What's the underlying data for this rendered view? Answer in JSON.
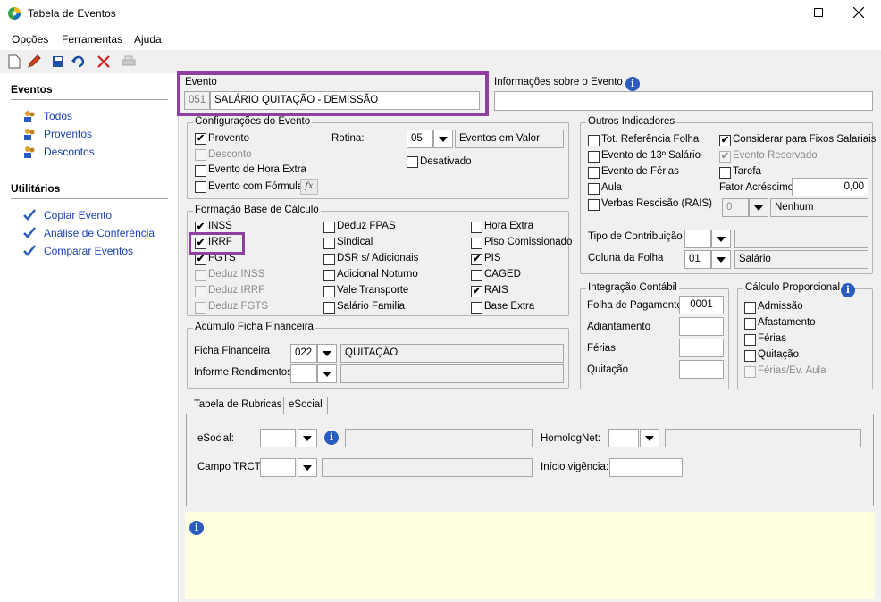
{
  "window": {
    "title": "Tabela de Eventos"
  },
  "menu": [
    "Opções",
    "Ferramentas",
    "Ajuda"
  ],
  "toolbar": [
    "new-doc-icon",
    "edit-icon",
    "save-icon",
    "undo-icon",
    "delete-icon",
    "print-icon"
  ],
  "sidebar": {
    "events_header": "Eventos",
    "events": [
      "Todos",
      "Proventos",
      "Descontos"
    ],
    "utils_header": "Utilitários",
    "utils": [
      "Copiar Evento",
      "Análise de Conferência",
      "Comparar Eventos"
    ]
  },
  "evento": {
    "legend": "Evento",
    "code": "051",
    "name": "SALÁRIO QUITAÇÃO - DEMISSÃO"
  },
  "info_evento": {
    "label": "Informações sobre o Evento",
    "value": ""
  },
  "config": {
    "legend": "Configurações do Evento",
    "provento": "Provento",
    "provento_checked": true,
    "desconto": "Desconto",
    "hora_extra": "Evento de Hora Extra",
    "formula": "Evento com Fórmula",
    "fx": "fx",
    "rotina_label": "Rotina:",
    "rotina_code": "05",
    "rotina_desc": "Eventos em Valor",
    "desativado": "Desativado"
  },
  "base": {
    "legend": "Formação Base de Cálculo",
    "col1": [
      {
        "label": "INSS",
        "checked": true,
        "disabled": false
      },
      {
        "label": "IRRF",
        "checked": true,
        "disabled": false
      },
      {
        "label": "FGTS",
        "checked": true,
        "disabled": false
      },
      {
        "label": "Deduz INSS",
        "checked": false,
        "disabled": true
      },
      {
        "label": "Deduz IRRF",
        "checked": false,
        "disabled": true
      },
      {
        "label": "Deduz FGTS",
        "checked": false,
        "disabled": true
      }
    ],
    "col2": [
      {
        "label": "Deduz FPAS",
        "checked": false
      },
      {
        "label": "Sindical",
        "checked": false
      },
      {
        "label": "DSR s/ Adicionais",
        "checked": false
      },
      {
        "label": "Adicional Noturno",
        "checked": false
      },
      {
        "label": "Vale Transporte",
        "checked": false
      },
      {
        "label": "Salário Familia",
        "checked": false
      }
    ],
    "col3": [
      {
        "label": "Hora Extra",
        "checked": false
      },
      {
        "label": "Piso Comissionado",
        "checked": false
      },
      {
        "label": "PIS",
        "checked": true
      },
      {
        "label": "CAGED",
        "checked": false
      },
      {
        "label": "RAIS",
        "checked": true
      },
      {
        "label": "Base Extra",
        "checked": false
      }
    ]
  },
  "acumulo": {
    "legend": "Acúmulo Ficha Financeira",
    "ficha_label": "Ficha Financeira",
    "ficha_code": "022",
    "ficha_desc": "QUITAÇÃO",
    "informe_label": "Informe Rendimentos",
    "informe_code": "",
    "informe_desc": ""
  },
  "outros": {
    "legend": "Outros Indicadores",
    "left": [
      {
        "label": "Tot. Referência Folha",
        "checked": false
      },
      {
        "label": "Evento de 13º Salário",
        "checked": false
      },
      {
        "label": "Evento de Férias",
        "checked": false
      },
      {
        "label": "Aula",
        "checked": false
      },
      {
        "label": "Verbas Rescisão (RAIS)",
        "checked": false
      }
    ],
    "right": [
      {
        "label": "Considerar para Fixos Salariais",
        "checked": true,
        "disabled": false
      },
      {
        "label": "Evento Reservado",
        "checked": true,
        "disabled": true
      },
      {
        "label": "Tarefa",
        "checked": false,
        "disabled": false
      }
    ],
    "fator_label": "Fator Acréscimo",
    "fator_value": "0,00",
    "rais_code": "0",
    "rais_desc": "Nenhum",
    "tipo_contrib_label": "Tipo de Contribuição",
    "tipo_contrib_code": "",
    "coluna_label": "Coluna da Folha",
    "coluna_code": "01",
    "coluna_desc": "Salário"
  },
  "integracao": {
    "legend": "Integração Contábil",
    "fields": [
      {
        "label": "Folha de Pagamento",
        "value": "0001"
      },
      {
        "label": "Adiantamento",
        "value": ""
      },
      {
        "label": "Férias",
        "value": ""
      },
      {
        "label": "Quitação",
        "value": ""
      }
    ]
  },
  "proporcional": {
    "legend": "Cálculo Proporcional",
    "items": [
      {
        "label": "Admissão",
        "disabled": false
      },
      {
        "label": "Afastamento",
        "disabled": false
      },
      {
        "label": "Férias",
        "disabled": false
      },
      {
        "label": "Quitação",
        "disabled": false
      },
      {
        "label": "Férias/Ev. Aula",
        "disabled": true
      }
    ]
  },
  "tabs": [
    "Tabela de Rubricas",
    "eSocial"
  ],
  "rubricas": {
    "esocial_label": "eSocial:",
    "homolognet_label": "HomologNet:",
    "trct_label": "Campo TRCT:",
    "inicio_label": "Início vigência:"
  },
  "colors": {
    "highlight": "#8e3fa0",
    "info_panel": "#ffffe1",
    "link": "#1a3fb0"
  }
}
